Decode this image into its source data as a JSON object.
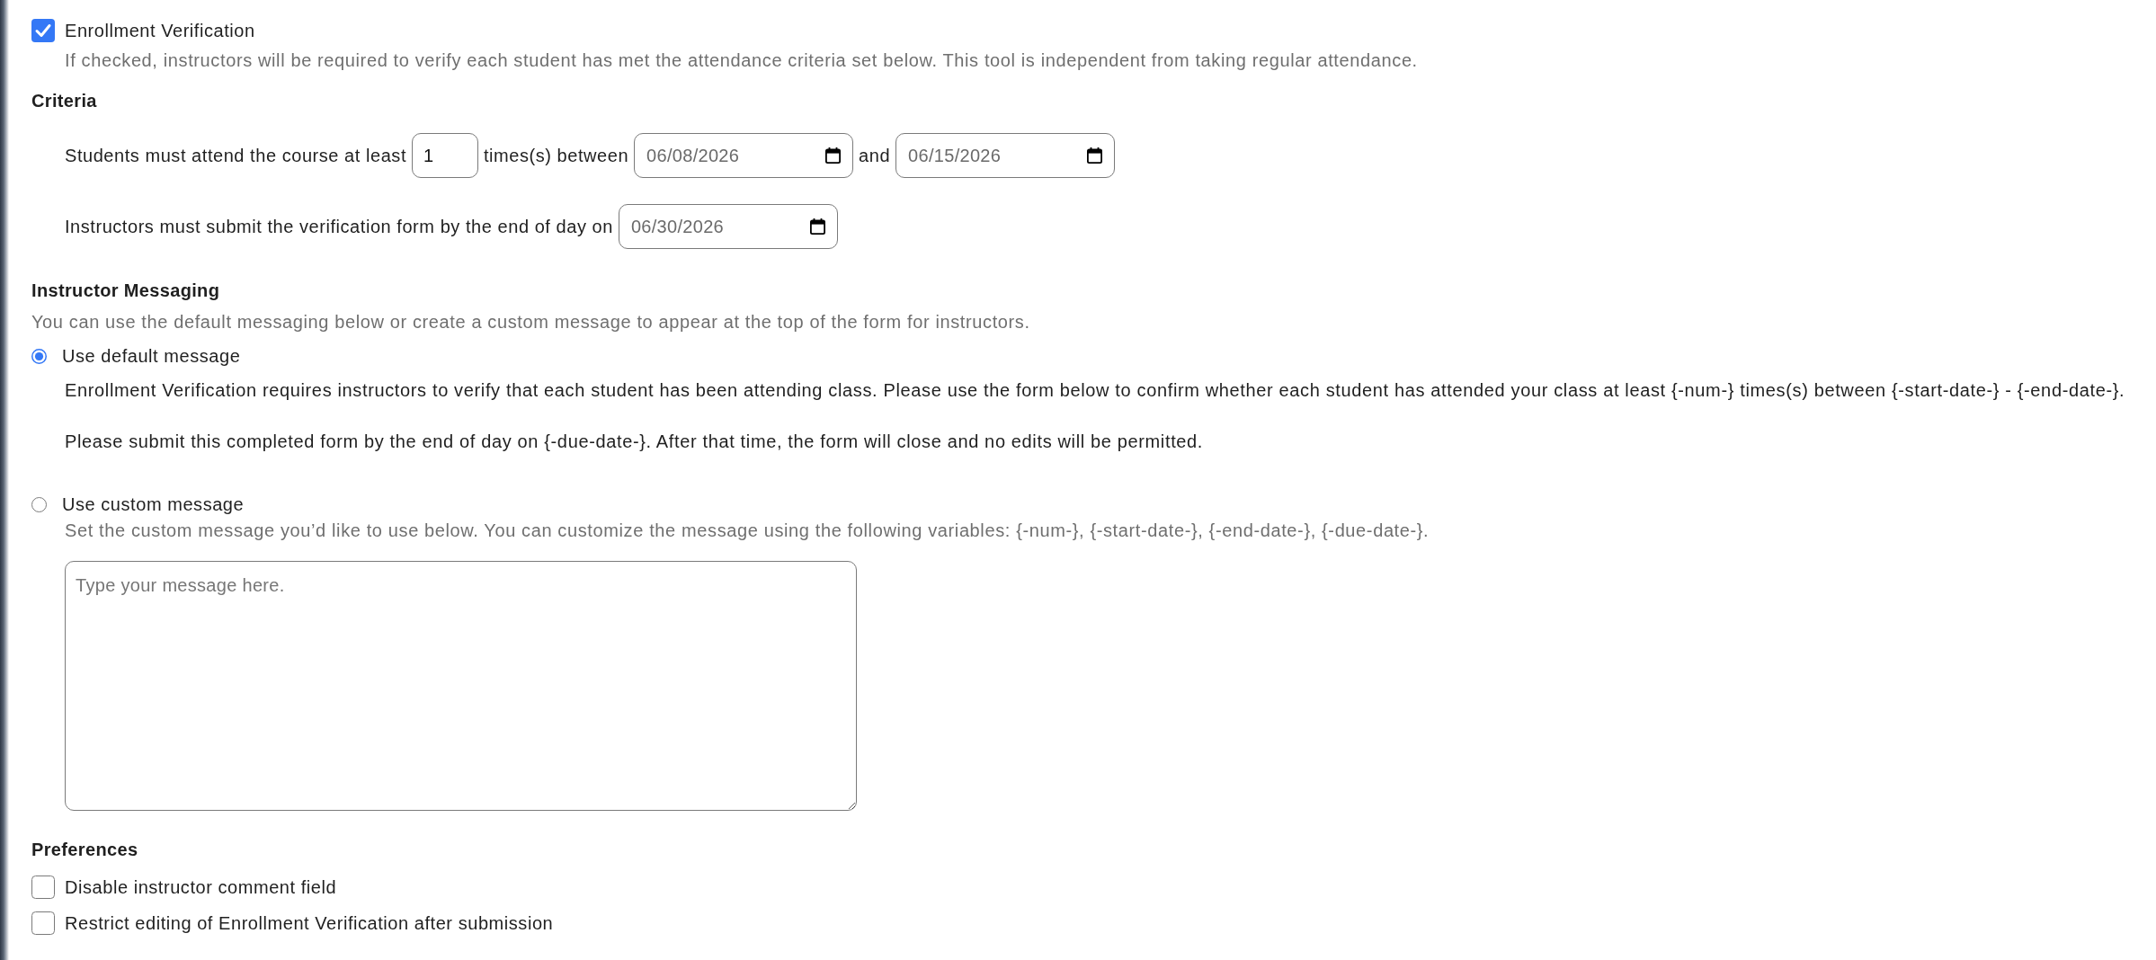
{
  "enrollment_verification": {
    "label": "Enrollment Verification",
    "checked": true,
    "description": "If checked, instructors will be required to verify each student has met the attendance criteria set below. This tool is independent from taking regular attendance."
  },
  "criteria": {
    "heading": "Criteria",
    "attendance": {
      "text_before": "Students must attend the course at least",
      "count": "1",
      "text_between": "times(s) between",
      "start_date": "06/08/2026",
      "text_and": "and",
      "end_date": "06/15/2026"
    },
    "deadline": {
      "text": "Instructors must submit the verification form by the end of day on",
      "due_date": "06/30/2026"
    }
  },
  "instructor_messaging": {
    "heading": "Instructor Messaging",
    "description": "You can use the default messaging below or create a custom message to appear at the top of the form for instructors.",
    "options": [
      {
        "kind": "preview",
        "label": "Use default message",
        "selected": true,
        "paragraphs": [
          "Enrollment Verification requires instructors to verify that each student has been attending class. Please use the form below to confirm whether each student has attended your class at least {-num-} times(s) between {-start-date-} - {-end-date-}.",
          "Please submit this completed form by the end of day on {-due-date-}. After that time, the form will close and no edits will be permitted."
        ]
      },
      {
        "kind": "editor",
        "label": "Use custom message",
        "selected": false,
        "description": "Set the custom message you’d like to use below. You can customize the message using the following variables: {-num-}, {-start-date-}, {-end-date-}, {-due-date-}.",
        "placeholder": "Type your message here."
      }
    ]
  },
  "preferences": {
    "heading": "Preferences",
    "items": [
      {
        "label": "Disable instructor comment field",
        "checked": false
      },
      {
        "label": "Restrict editing of Enrollment Verification after submission",
        "checked": false
      }
    ]
  }
}
